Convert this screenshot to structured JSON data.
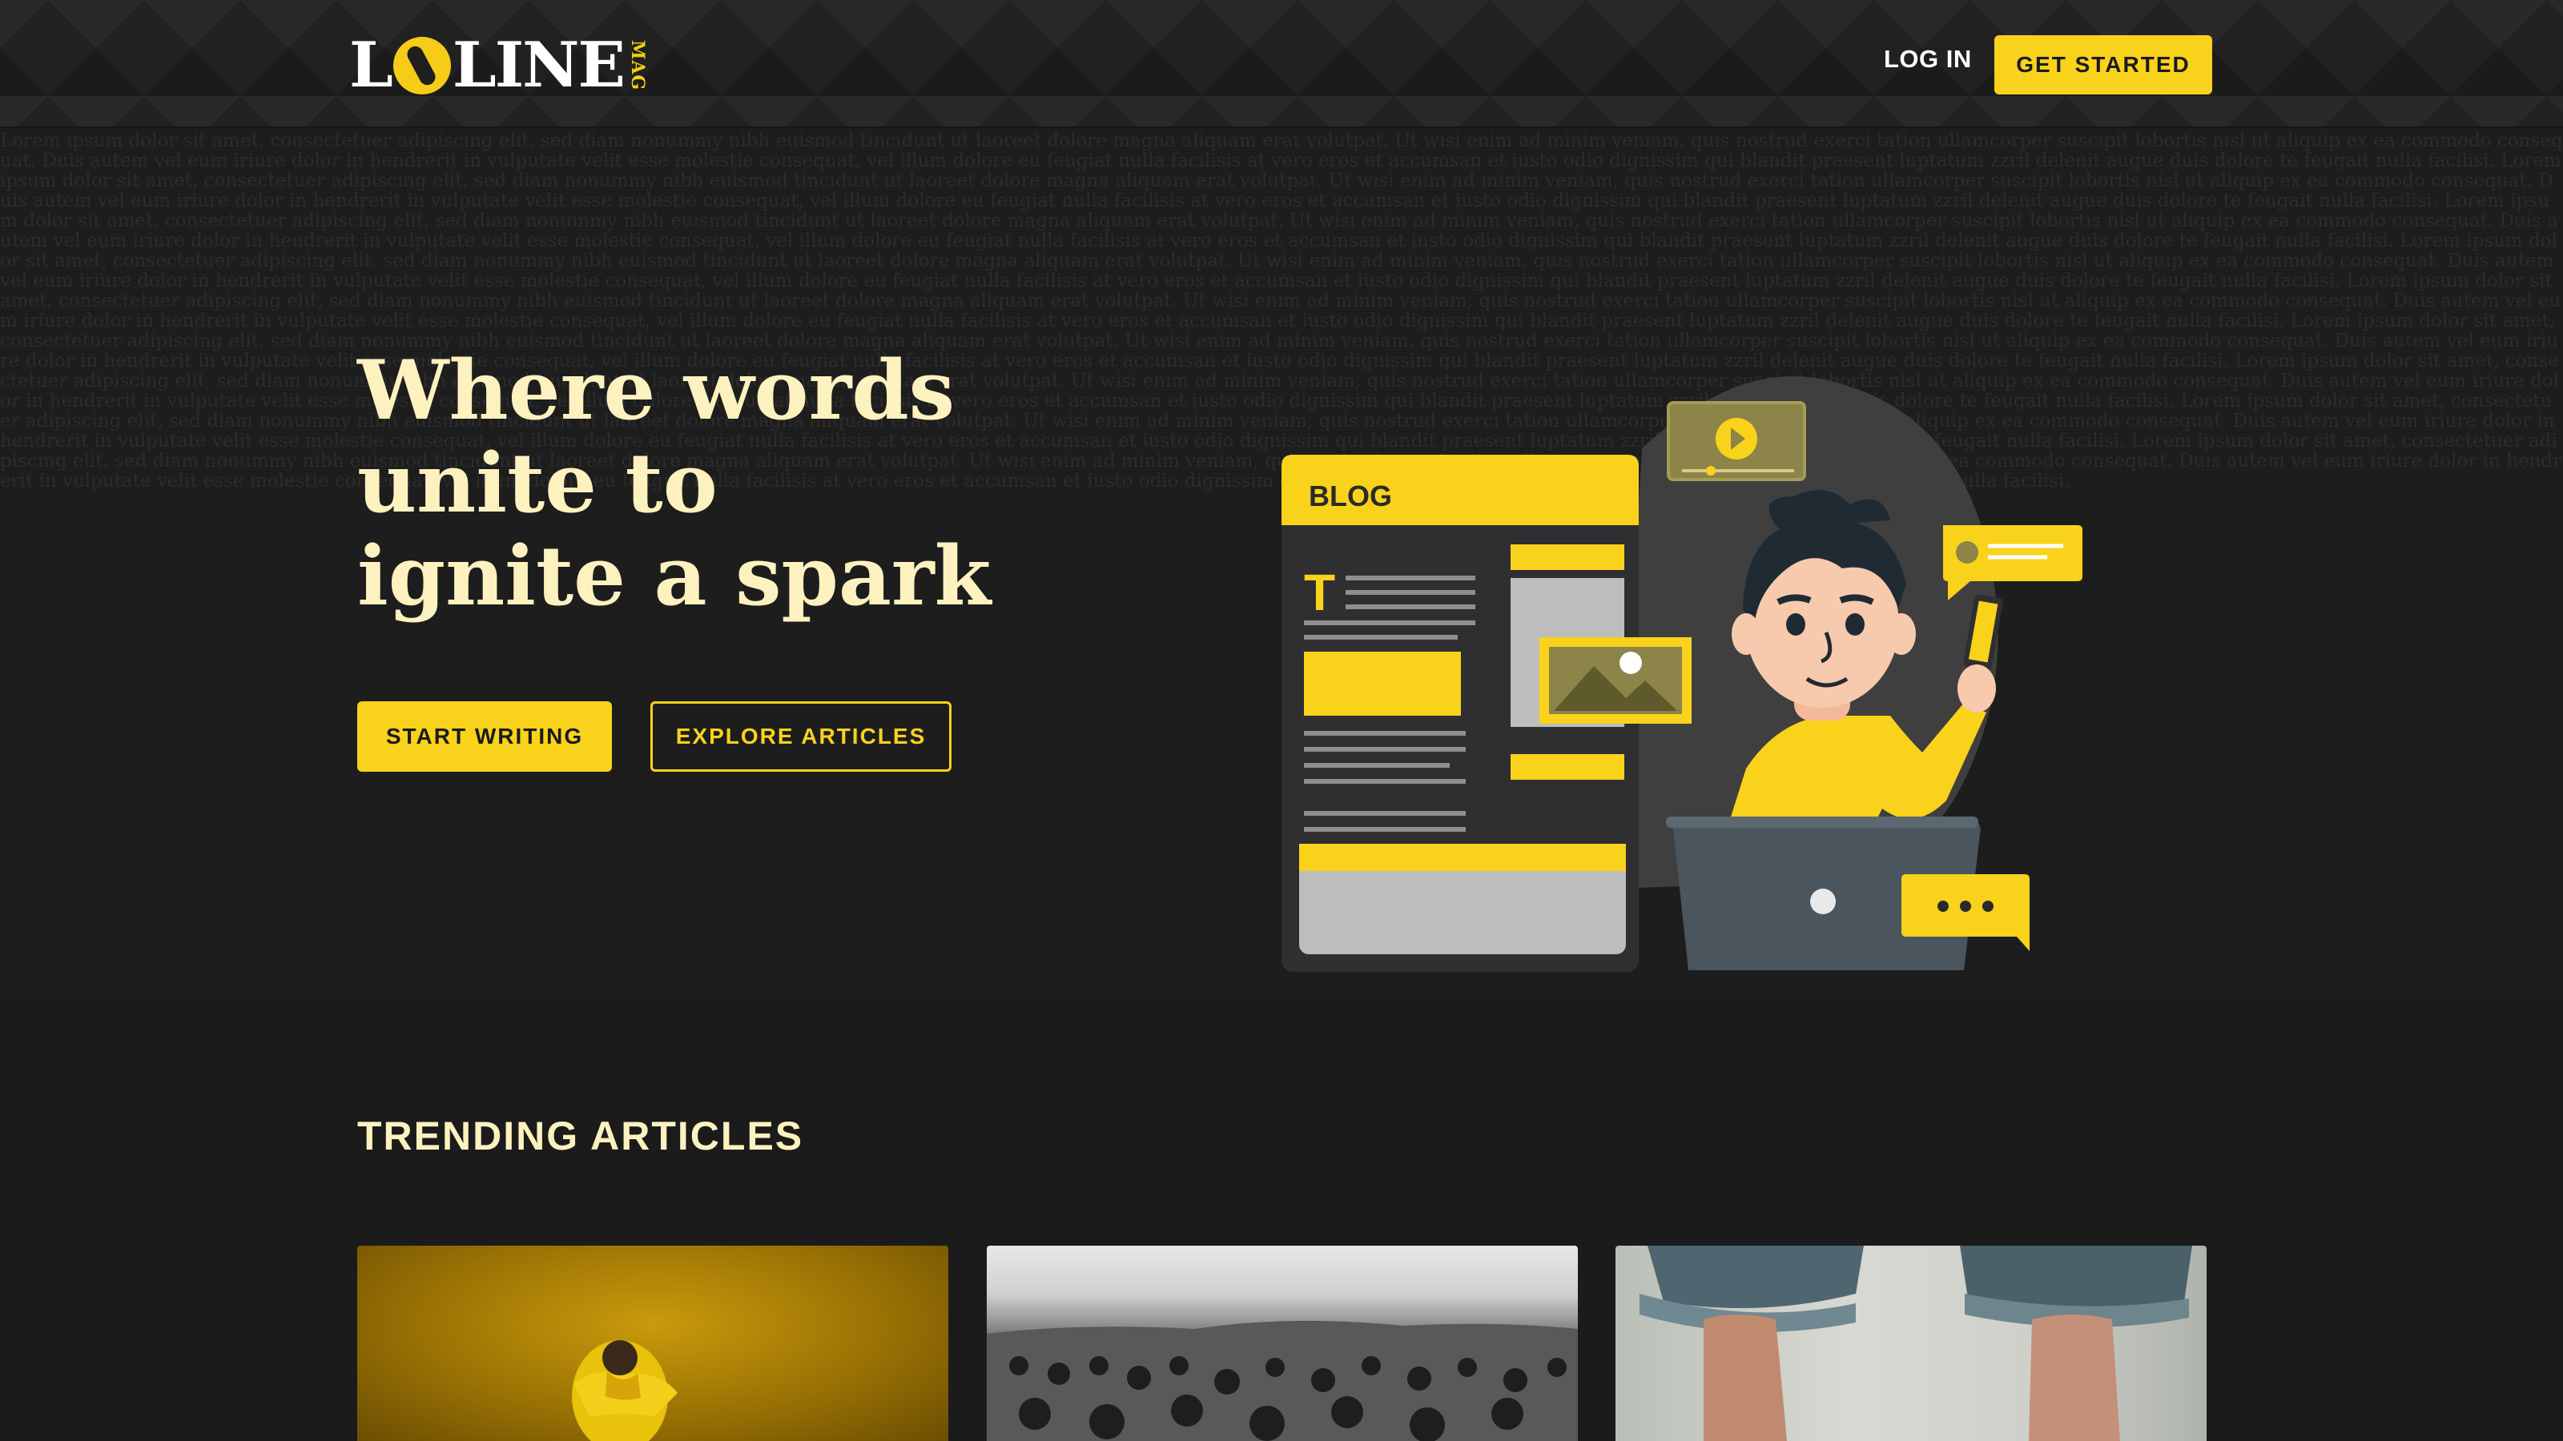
{
  "header": {
    "logo_letters": "L",
    "logo_rest": "LINE",
    "logo_mag": "MAG",
    "login_label": "LOG IN",
    "get_started_label": "GET STARTED"
  },
  "hero": {
    "headline": "Where words unite to ignite a spark",
    "start_writing_label": "START WRITING",
    "explore_label": "EXPLORE ARTICLES",
    "illustration": {
      "blog_label": "BLOG",
      "heading_glyph": "T"
    },
    "background_texture": "Lorem ipsum dolor sit amet, consectetuer adipiscing elit, sed diam nonummy nibh euismod tincidunt ut laoreet dolore magna aliquam erat volutpat. Ut wisi enim ad minim veniam, quis nostrud exerci tation ullamcorper suscipit lobortis nisl ut aliquip ex ea commodo consequat. Duis autem vel eum iriure dolor in hendrerit in vulputate velit esse molestie consequat, vel illum dolore eu feugiat nulla facilisis at vero eros et accumsan et iusto odio dignissim qui blandit praesent luptatum zzril delenit augue duis dolore te feugait nulla facilisi. Lorem ipsum dolor sit amet, consectetuer adipiscing elit, sed diam nonummy nibh euismod tincidunt ut laoreet dolore magna aliquam erat volutpat. Ut wisi enim ad minim veniam, quis nostrud exerci tation ullamcorper suscipit lobortis nisl ut aliquip ex ea commodo consequat. Duis autem vel eum iriure dolor in hendrerit in vulputate velit esse molestie consequat, vel illum dolore eu feugiat nulla facilisis at vero eros et accumsan et iusto odio dignissim qui blandit praesent luptatum zzril delenit augue duis dolore te feugait nulla facilisi. Lorem ipsum dolor sit amet, consectetuer adipiscing elit, sed diam nonummy nibh euismod tincidunt ut laoreet dolore magna aliquam erat volutpat. Ut wisi enim ad minim veniam, quis nostrud exerci tation ullamcorper suscipit lobortis nisl ut aliquip ex ea commodo consequat. Duis autem vel eum iriure dolor in hendrerit in vulputate velit esse molestie consequat, vel illum dolore eu feugiat nulla facilisis at vero eros et accumsan et iusto odio dignissim qui blandit praesent luptatum zzril delenit augue duis dolore te feugait nulla facilisi. Lorem ipsum dolor sit amet, consectetuer adipiscing elit, sed diam nonummy nibh euismod tincidunt ut laoreet dolore magna aliquam erat volutpat. Ut wisi enim ad minim veniam, quis nostrud exerci tation ullamcorper suscipit lobortis nisl ut aliquip ex ea commodo consequat. Duis autem vel eum iriure dolor in hendrerit in vulputate velit esse molestie consequat, vel illum dolore eu feugiat nulla facilisis at vero eros et accumsan et iusto odio dignissim qui blandit praesent luptatum zzril delenit augue duis dolore te feugait nulla facilisi. Lorem ipsum dolor sit amet, consectetuer adipiscing elit, sed diam nonummy nibh euismod tincidunt ut laoreet dolore magna aliquam erat volutpat. Ut wisi enim ad minim veniam, quis nostrud exerci tation ullamcorper suscipit lobortis nisl ut aliquip ex ea commodo consequat. Duis autem vel eum iriure dolor in hendrerit in vulputate velit esse molestie consequat, vel illum dolore eu feugiat nulla facilisis at vero eros et accumsan et iusto odio dignissim qui blandit praesent luptatum zzril delenit augue duis dolore te feugait nulla facilisi. Lorem ipsum dolor sit amet, consectetuer adipiscing elit, sed diam nonummy nibh euismod tincidunt ut laoreet dolore magna aliquam erat volutpat. Ut wisi enim ad minim veniam, quis nostrud exerci tation ullamcorper suscipit lobortis nisl ut aliquip ex ea commodo consequat. Duis autem vel eum iriure dolor in hendrerit in vulputate velit esse molestie consequat, vel illum dolore eu feugiat nulla facilisis at vero eros et accumsan et iusto odio dignissim qui blandit praesent luptatum zzril delenit augue duis dolore te feugait nulla facilisi. Lorem ipsum dolor sit amet, consectetuer adipiscing elit, sed diam nonummy nibh euismod tincidunt ut laoreet dolore magna aliquam erat volutpat. Ut wisi enim ad minim veniam, quis nostrud exerci tation ullamcorper suscipit lobortis nisl ut aliquip ex ea commodo consequat. Duis autem vel eum iriure dolor in hendrerit in vulputate velit esse molestie consequat, vel illum dolore eu feugiat nulla facilisis at vero eros et accumsan et iusto odio dignissim qui blandit praesent luptatum zzril delenit augue duis dolore te feugait nulla facilisi. Lorem ipsum dolor sit amet, consectetuer adipiscing elit, sed diam nonummy nibh euismod tincidunt ut laoreet dolore magna aliquam erat volutpat. Ut wisi enim ad minim veniam, quis nostrud exerci tation ullamcorper suscipit lobortis nisl ut aliquip ex ea commodo consequat. Duis autem vel eum iriure dolor in hendrerit in vulputate velit esse molestie consequat, vel illum dolore eu feugiat nulla facilisis at vero eros et accumsan et iusto odio dignissim qui blandit praesent luptatum zzril delenit augue duis dolore te feugait nulla facilisi. Lorem ipsum dolor sit amet, consectetuer adipiscing elit, sed diam nonummy nibh euismod tincidunt ut laoreet dolore magna aliquam erat volutpat. Ut wisi enim ad minim veniam, quis nostrud exerci tation ullamcorper suscipit lobortis nisl ut aliquip ex ea commodo consequat. Duis autem vel eum iriure dolor in hendrerit in vulputate velit esse molestie consequat, vel illum dolore eu feugiat nulla facilisis at vero eros et accumsan et iusto odio dignissim qui blandit praesent luptatum zzril delenit augue duis dolore te feugait nulla facilisi."
  },
  "trending": {
    "title": "TRENDING ARTICLES",
    "cards": [
      {
        "image": "person in yellow jacket on yellow background"
      },
      {
        "image": "black and white sunflower field"
      },
      {
        "image": "bare feet and rolled-up jeans"
      }
    ]
  },
  "colors": {
    "accent": "#f9d21b",
    "headline": "#fdf2bf",
    "background": "#1b1b1b",
    "header_bg": "#212121"
  }
}
